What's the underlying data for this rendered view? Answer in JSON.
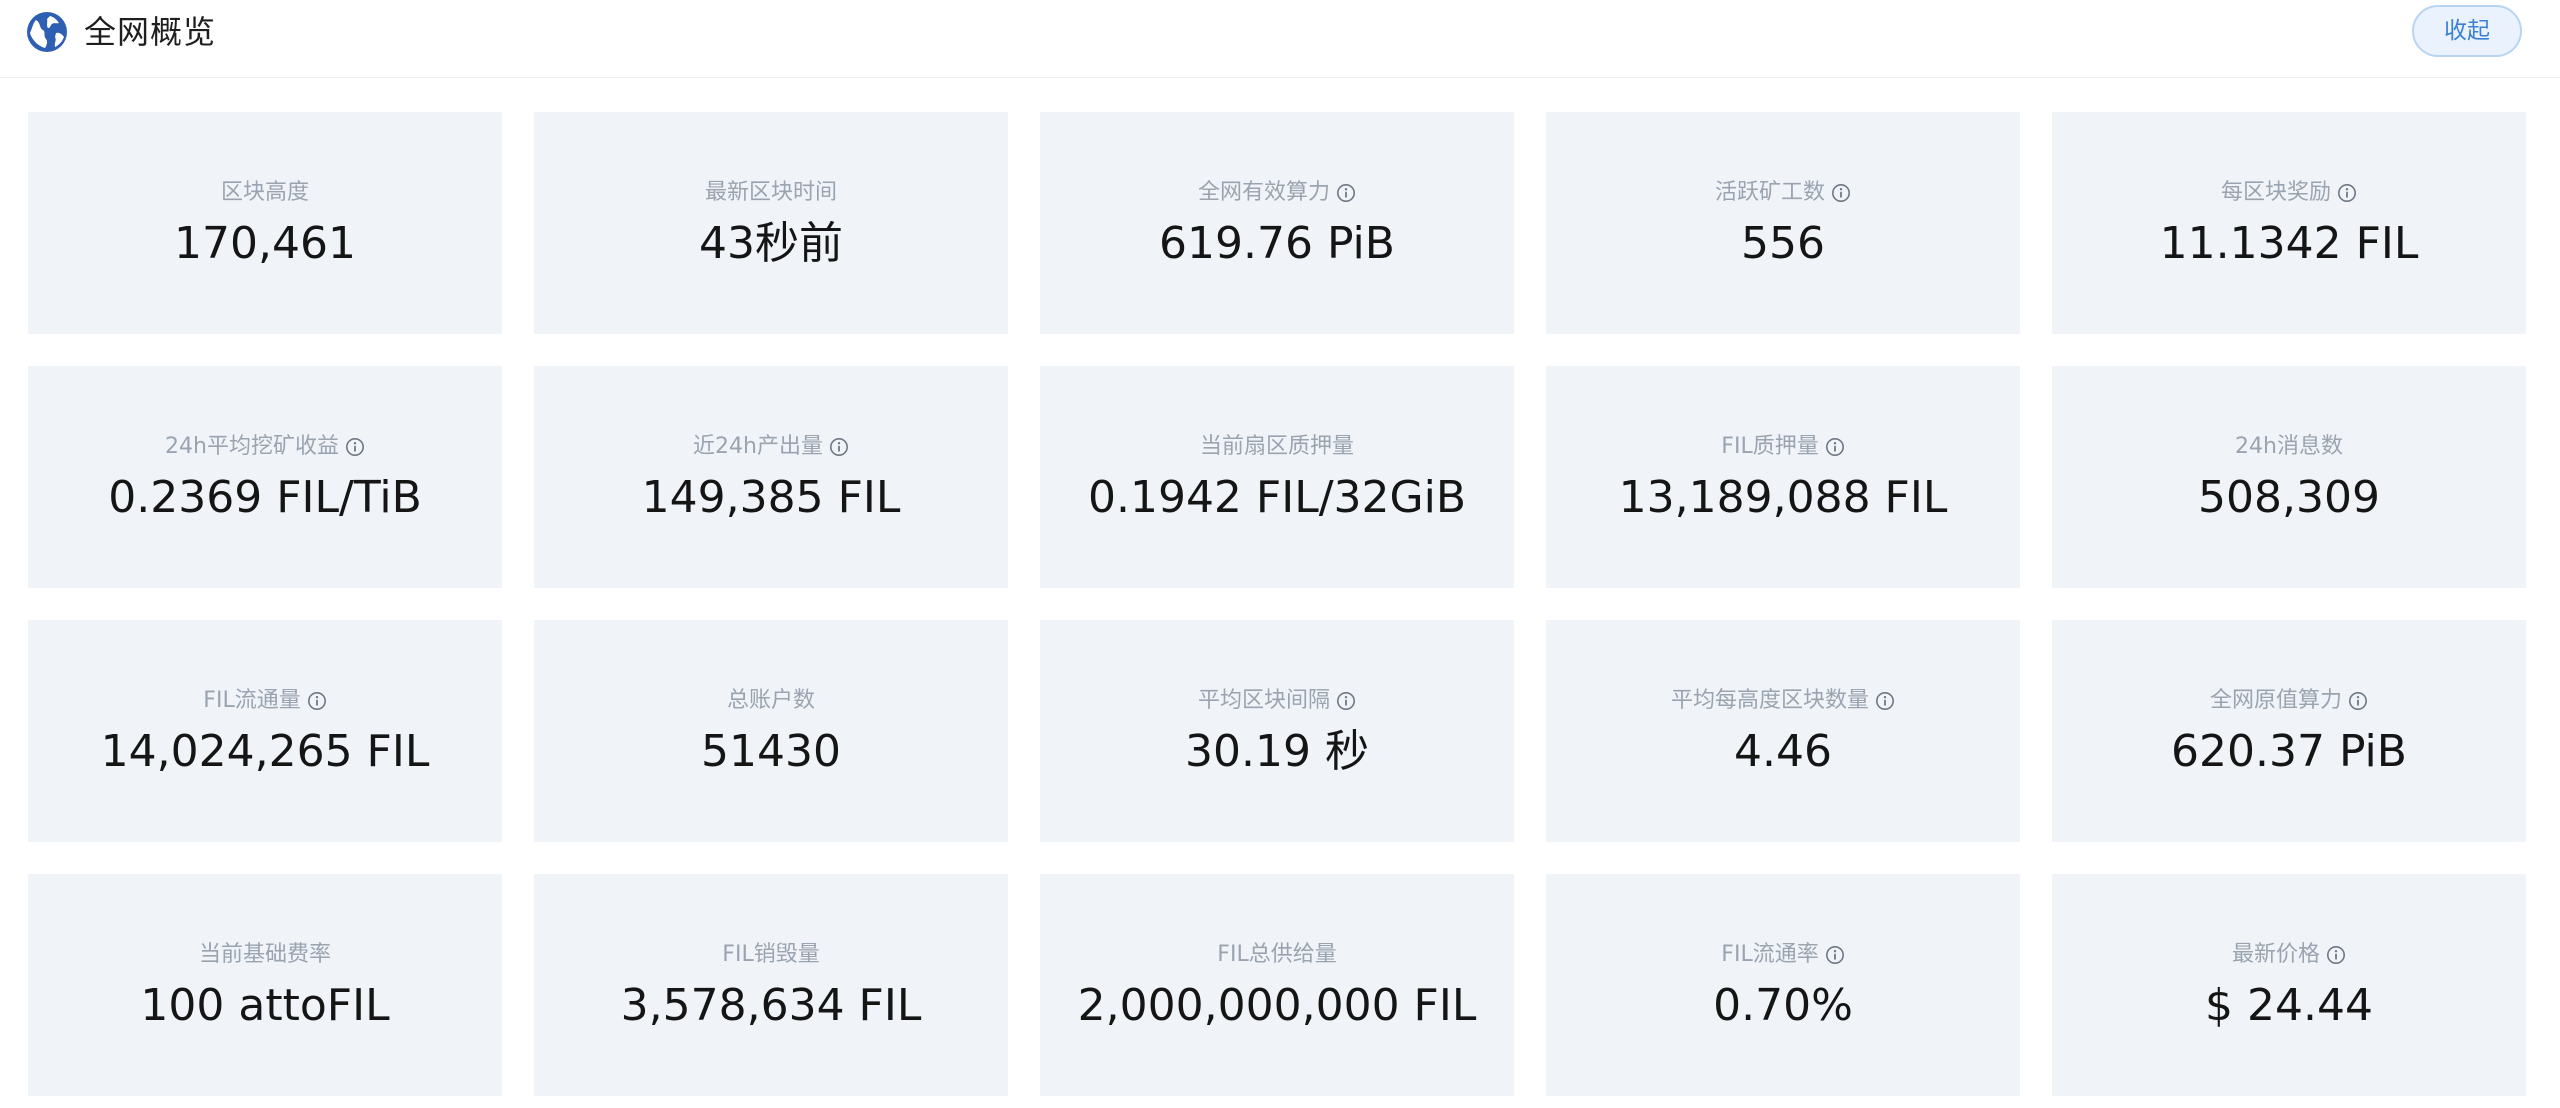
{
  "header": {
    "title": "全网概览",
    "icon": "globe-icon",
    "collapse_label": "收起"
  },
  "colors": {
    "accent": "#3b7fd6",
    "card_bg": "#f0f4f9",
    "label": "#9aa3b0",
    "value": "#151515"
  },
  "stats": [
    {
      "label": "区块高度",
      "value": "170,461",
      "info": false
    },
    {
      "label": "最新区块时间",
      "value": "43秒前",
      "info": false
    },
    {
      "label": "全网有效算力",
      "value": "619.76 PiB",
      "info": true
    },
    {
      "label": "活跃矿工数",
      "value": "556",
      "info": true
    },
    {
      "label": "每区块奖励",
      "value": "11.1342 FIL",
      "info": true
    },
    {
      "label": "24h平均挖矿收益",
      "value": "0.2369 FIL/TiB",
      "info": true
    },
    {
      "label": "近24h产出量",
      "value": "149,385 FIL",
      "info": true
    },
    {
      "label": "当前扇区质押量",
      "value": "0.1942 FIL/32GiB",
      "info": false
    },
    {
      "label": "FIL质押量",
      "value": "13,189,088 FIL",
      "info": true
    },
    {
      "label": "24h消息数",
      "value": "508,309",
      "info": false
    },
    {
      "label": "FIL流通量",
      "value": "14,024,265 FIL",
      "info": true
    },
    {
      "label": "总账户数",
      "value": "51430",
      "info": false
    },
    {
      "label": "平均区块间隔",
      "value": "30.19 秒",
      "info": true
    },
    {
      "label": "平均每高度区块数量",
      "value": "4.46",
      "info": true
    },
    {
      "label": "全网原值算力",
      "value": "620.37 PiB",
      "info": true
    },
    {
      "label": "当前基础费率",
      "value": "100 attoFIL",
      "info": false
    },
    {
      "label": "FIL销毁量",
      "value": "3,578,634 FIL",
      "info": false
    },
    {
      "label": "FIL总供给量",
      "value": "2,000,000,000 FIL",
      "info": false
    },
    {
      "label": "FIL流通率",
      "value": "0.70%",
      "info": true
    },
    {
      "label": "最新价格",
      "value": "$ 24.44",
      "info": true
    }
  ]
}
